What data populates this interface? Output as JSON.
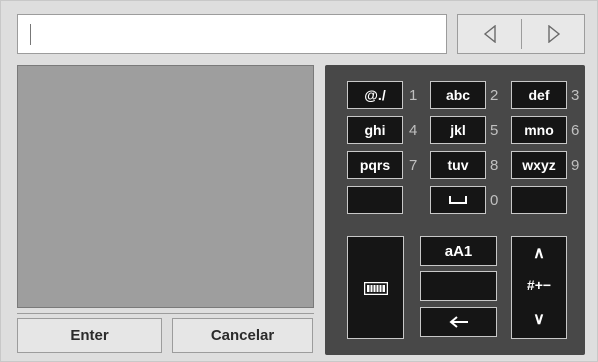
{
  "input": {
    "value": ""
  },
  "nav": {
    "left_icon": "triangle-left-icon",
    "right_icon": "triangle-right-icon"
  },
  "actions": {
    "enter_label": "Enter",
    "cancel_label": "Cancelar"
  },
  "keypad": {
    "keys": [
      {
        "label": "@./",
        "num": "1"
      },
      {
        "label": "abc",
        "num": "2"
      },
      {
        "label": "def",
        "num": "3"
      },
      {
        "label": "ghi",
        "num": "4"
      },
      {
        "label": "jkl",
        "num": "5"
      },
      {
        "label": "mno",
        "num": "6"
      },
      {
        "label": "pqrs",
        "num": "7"
      },
      {
        "label": "tuv",
        "num": "8"
      },
      {
        "label": "wxyz",
        "num": "9"
      },
      {
        "label": "",
        "num": ""
      },
      {
        "label": "space-icon",
        "num": "0"
      },
      {
        "label": "",
        "num": ""
      }
    ],
    "case_label": "aA1",
    "symbols_label": "#+−",
    "up_glyph": "∧",
    "down_glyph": "∨",
    "backspace_icon": "arrow-left-icon",
    "keyboard_icon": "keyboard-icon"
  }
}
